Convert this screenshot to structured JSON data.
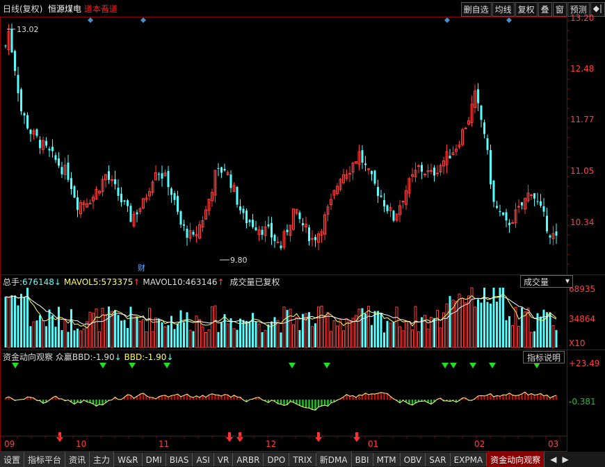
{
  "header": {
    "period": "日线(复权)",
    "stock_name": "恒源煤电",
    "promo": "道本吾道",
    "buttons": [
      "删自选",
      "均线",
      "复权",
      "叠",
      "窗",
      "预测",
      "◆|"
    ]
  },
  "price_axis": {
    "labels": [
      "13.20",
      "12.48",
      "11.77",
      "11.05",
      "10.34"
    ]
  },
  "annotations": {
    "high": "13.02",
    "low": "9.80",
    "finance_marker": "财"
  },
  "volume": {
    "total_label": "总手:",
    "total_value": "676148",
    "mavol5_label": "MAVOL5:",
    "mavol5_value": "573375",
    "mavol10_label": "MAVOL10:",
    "mavol10_value": "463146",
    "note": "成交量已复权",
    "selector": "成交量",
    "axis_labels": [
      "68935",
      "34864"
    ],
    "axis_unit": "X10"
  },
  "indicator": {
    "name": "资金动向观察",
    "bbd_label1": "众赢BBD:",
    "bbd_value1": "-1.90",
    "bbd_label2": "BBD:",
    "bbd_value2": "-1.90",
    "help_button": "指标说明",
    "axis_labels": [
      "+23.49",
      "-0.381"
    ]
  },
  "dates": [
    "09",
    "10",
    "11",
    "12",
    "01",
    "02",
    "03"
  ],
  "tabs": [
    "设置",
    "指标平台",
    "资讯",
    "主力",
    "W&R",
    "DMI",
    "BIAS",
    "ASI",
    "VR",
    "ARBR",
    "DPO",
    "TRIX",
    "新DMA",
    "BBI",
    "MTM",
    "OBV",
    "SAR",
    "EXPMA",
    "资金动向观察"
  ],
  "active_tab": "资金动向观察",
  "colors": {
    "up": "#ff3b3b",
    "down": "#54ffff",
    "axis": "#b00000",
    "indicator_pos": "#c01010",
    "indicator_neg": "#20c020"
  }
}
